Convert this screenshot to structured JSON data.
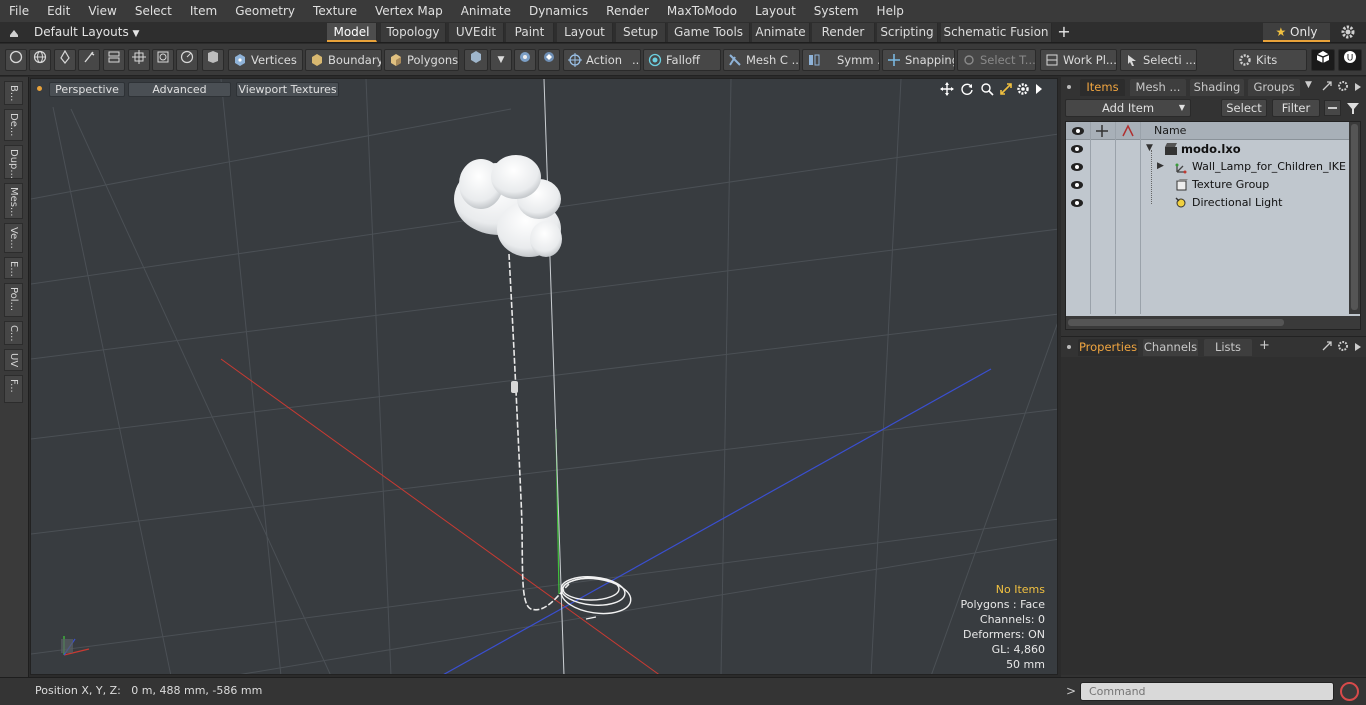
{
  "menu": [
    "File",
    "Edit",
    "View",
    "Select",
    "Item",
    "Geometry",
    "Texture",
    "Vertex Map",
    "Animate",
    "Dynamics",
    "Render",
    "MaxToModo",
    "Layout",
    "System",
    "Help"
  ],
  "layout": {
    "preset": "Default Layouts",
    "tabs": [
      "Model",
      "Topology",
      "UVEdit",
      "Paint",
      "Layout",
      "Setup",
      "Game Tools",
      "Animate",
      "Render",
      "Scripting",
      "Schematic Fusion"
    ],
    "active_tab": "Model",
    "only_label": "Only",
    "add_symbol": "+"
  },
  "toolbar": {
    "vertices": "Vertices",
    "boundary": "Boundary",
    "polygons": "Polygons",
    "action": "Action",
    "action_more": "...",
    "falloff": "Falloff",
    "mesh_c": "Mesh C ...",
    "symm": "Symm ...",
    "snapping": "Snapping",
    "select_t": "Select T...",
    "work_pl": "Work Pl...",
    "selecti": "Selecti ...",
    "kits": "Kits"
  },
  "left_tabs": [
    "B...",
    "De...",
    "Dup...",
    "Mes...",
    "Ve...",
    "E...",
    "Pol...",
    "C...",
    "UV",
    "F..."
  ],
  "viewport": {
    "perspective": "Perspective",
    "advanced": "Advanced",
    "viewport_textures": "Viewport Textures",
    "info": {
      "no_items": "No Items",
      "polygons": "Polygons : Face",
      "channels": "Channels: 0",
      "deformers": "Deformers: ON",
      "gl": "GL: 4,860",
      "scale": "50 mm"
    }
  },
  "items_panel": {
    "tabs": [
      "Items",
      "Mesh ...",
      "Shading",
      "Groups"
    ],
    "active_tab": "Items",
    "add_item": "Add Item",
    "select": "Select",
    "filter": "Filter",
    "column_name": "Name",
    "tree": [
      {
        "label": "modo.lxo"
      },
      {
        "label": "Wall_Lamp_for_Children_IKE ..."
      },
      {
        "label": "Texture Group"
      },
      {
        "label": "Directional Light"
      }
    ]
  },
  "properties_panel": {
    "tabs": [
      "Properties",
      "Channels",
      "Lists"
    ],
    "active_tab": "Properties",
    "add_symbol": "+"
  },
  "status": {
    "position": "Position X, Y, Z:   0 m, 488 mm, -586 mm",
    "command_placeholder": "Command",
    "prompt": ">"
  },
  "colors": {
    "accent": "#e8a23a",
    "x_axis": "#c83a32",
    "y_axis": "#3fc03a",
    "z_axis": "#3a4fd0",
    "viewport_bg": "#383c40"
  }
}
